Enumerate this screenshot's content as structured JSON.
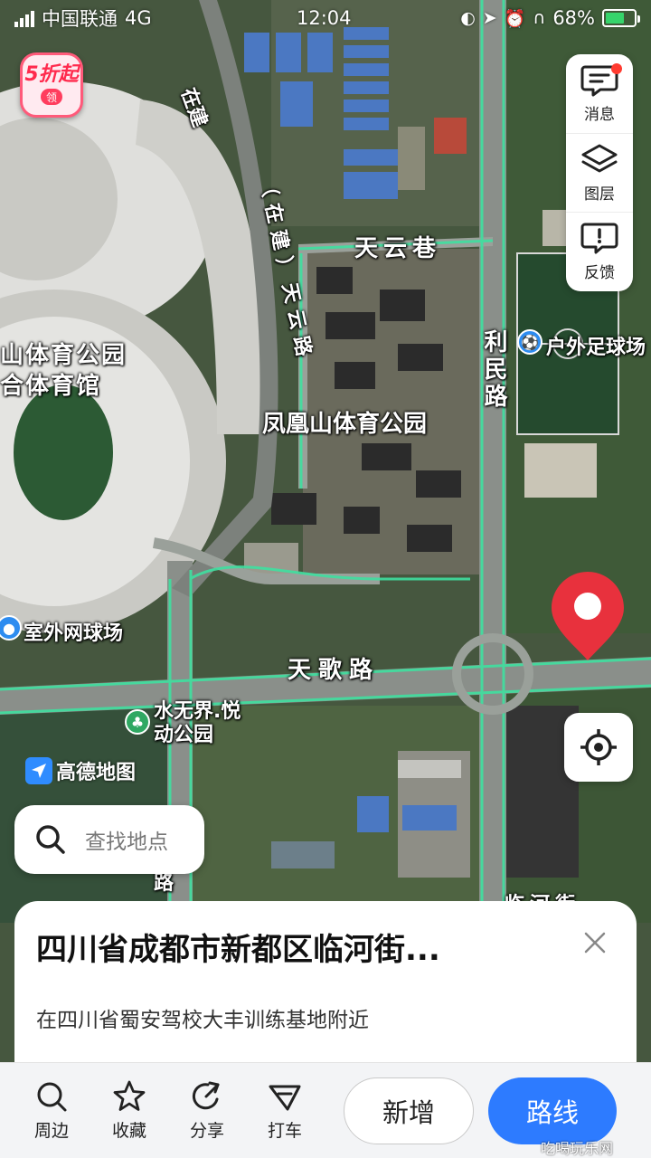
{
  "status_bar": {
    "carrier": "中国联通",
    "network": "4G",
    "time": "12:04",
    "battery": "68%",
    "battery_level": 0.68
  },
  "promo": {
    "label": "5折起",
    "coin": "领"
  },
  "controls": {
    "messages": "消息",
    "layers": "图层",
    "feedback": "反馈"
  },
  "map_labels": {
    "tianyun_lane": "天云巷",
    "construction_road": "（在建）天云路",
    "under_construction": "在建",
    "stadium_park_1": "山体育公园",
    "stadium_park_2": "合体育馆",
    "phoenix_park": "凤凰山体育公园",
    "limin_road": "利民路",
    "outdoor_football": "户外足球场",
    "outdoor_tennis": "室外网球场",
    "tiange_road": "天歌路",
    "water_park": "水无界.悦动公园",
    "linhe_street": "临河街",
    "side_road": "路"
  },
  "logo": {
    "text": "高德地图"
  },
  "search": {
    "placeholder": "查找地点"
  },
  "place_card": {
    "title": "四川省成都市新都区临河街...",
    "subtitle": "在四川省蜀安驾校大丰训练基地附近"
  },
  "actions": {
    "nearby": "周边",
    "favorite": "收藏",
    "share": "分享",
    "taxi": "打车",
    "add": "新增",
    "route": "路线"
  },
  "watermark": "吃喝玩乐网",
  "colors": {
    "accent": "#2d7bff",
    "pin": "#e8313d",
    "road_highlight": "#3fe0a0"
  }
}
